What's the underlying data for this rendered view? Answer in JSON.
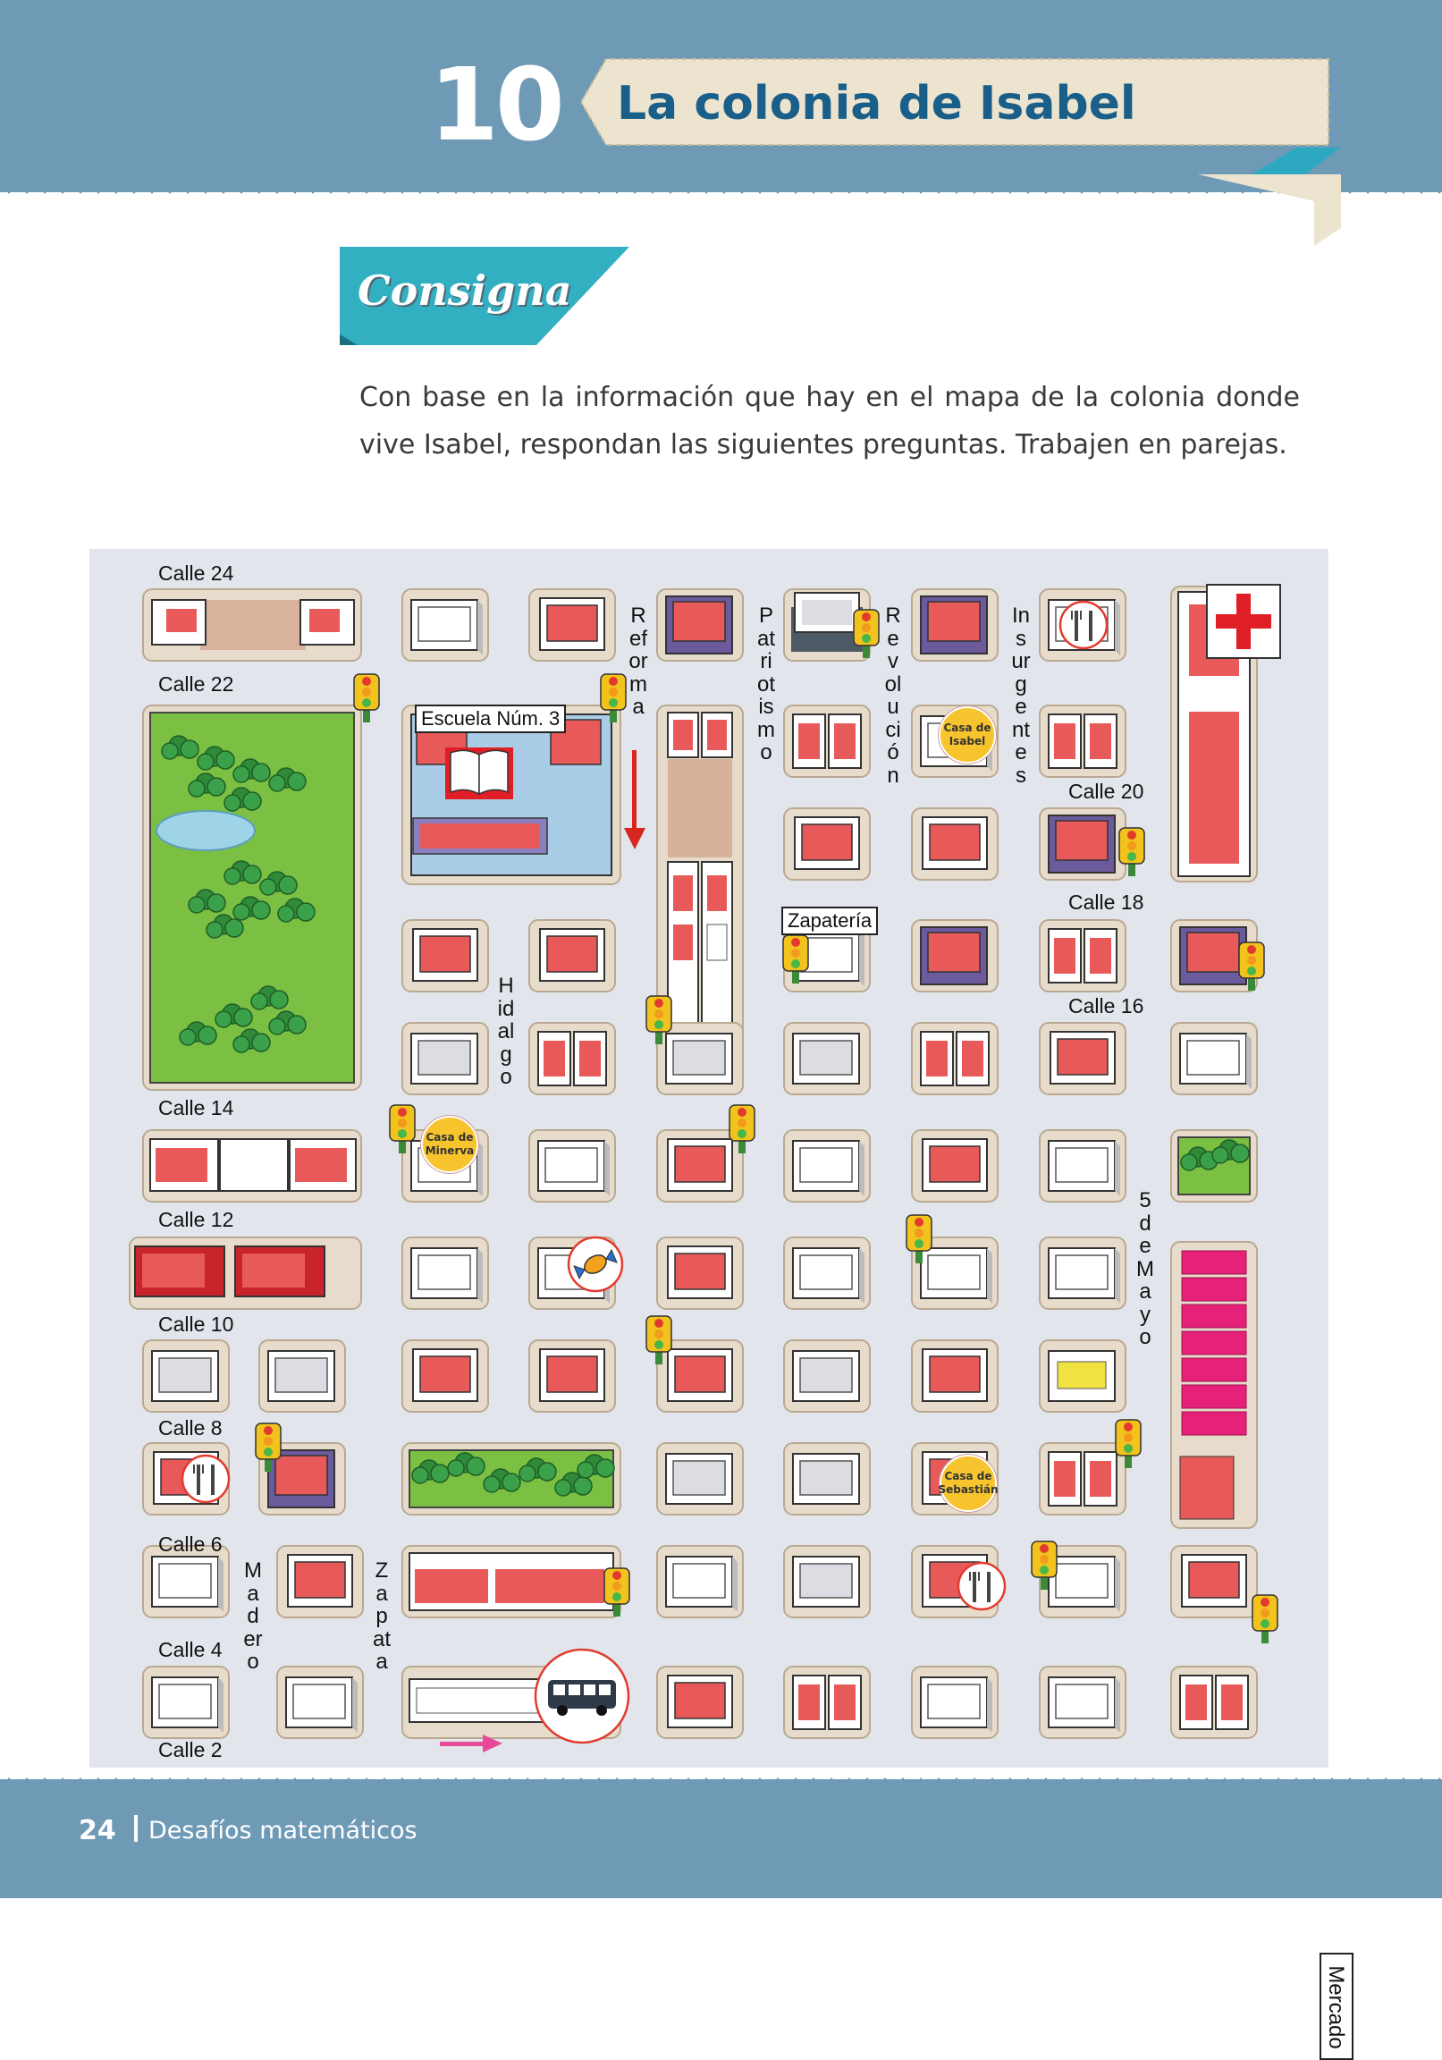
{
  "lesson": {
    "number": "10",
    "title": "La colonia de Isabel"
  },
  "consigna": {
    "label": "Consigna"
  },
  "instructions": "Con base en la información que hay en el mapa de la colonia donde vive Isabel, respondan las siguientes preguntas. Trabajen en parejas.",
  "map": {
    "streets_horizontal": [
      "Calle 24",
      "Calle 22",
      "Calle 20",
      "Calle 18",
      "Calle 16",
      "Calle 14",
      "Calle 12",
      "Calle 10",
      "Calle 8",
      "Calle 6",
      "Calle 4",
      "Calle 2"
    ],
    "streets_vertical": [
      "Reforma",
      "Patriotismo",
      "Revolución",
      "Insurgentes",
      "Hidalgo",
      "Madero",
      "Zapata",
      "5 de Mayo"
    ],
    "places": {
      "school": "Escuela Núm. 3",
      "shoe_store": "Zapatería",
      "market": "Mercado",
      "casa_isabel": "Casa de Isabel",
      "casa_minerva": "Casa de Minerva",
      "casa_sebastian": "Casa de Sebastián"
    },
    "icons": [
      "hospital-cross-icon",
      "restaurant-icon",
      "traffic-light-icon",
      "candy-icon",
      "bus-icon",
      "book-icon",
      "park-tree-icon",
      "one-way-arrow-icon"
    ],
    "colors": {
      "background": "#e2e6ec",
      "park": "#7bc043",
      "red_roof": "#e85a5a",
      "casa_marker": "#f7c42d",
      "one_way_red": "#d7261e",
      "one_way_pink": "#e84a9a"
    }
  },
  "footer": {
    "page": "24",
    "book": "Desafíos matemáticos"
  }
}
